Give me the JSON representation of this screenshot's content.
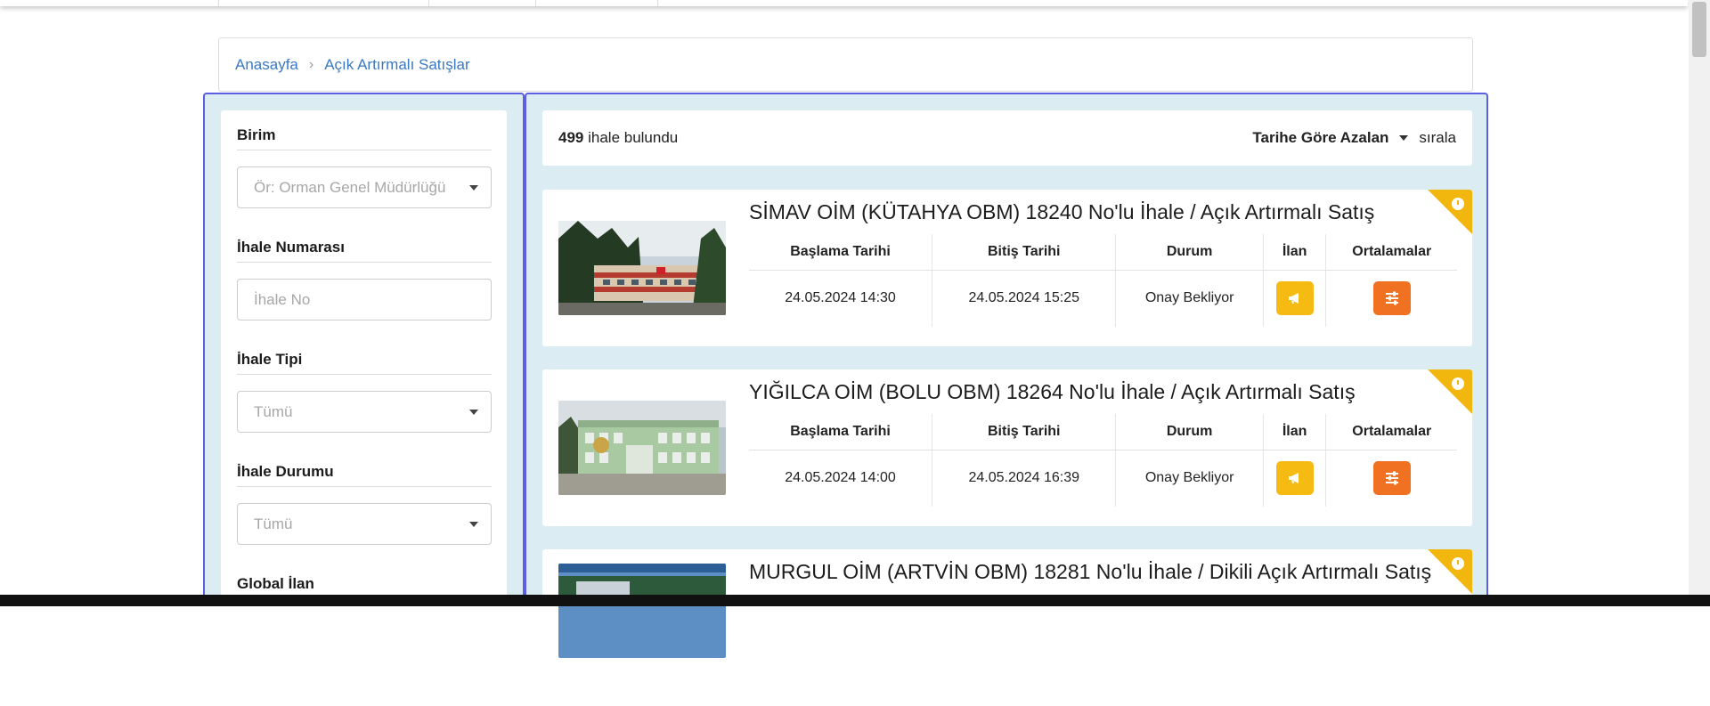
{
  "breadcrumb": {
    "home": "Anasayfa",
    "current": "Açık Artırmalı Satışlar"
  },
  "filters": [
    {
      "label": "Birim",
      "placeholder": "Ör: Orman Genel Müdürlüğü",
      "type": "select"
    },
    {
      "label": "İhale Numarası",
      "placeholder": "İhale No",
      "type": "input"
    },
    {
      "label": "İhale Tipi",
      "placeholder": "Tümü",
      "type": "select"
    },
    {
      "label": "İhale Durumu",
      "placeholder": "Tümü",
      "type": "select"
    },
    {
      "label": "Global İlan"
    }
  ],
  "summary": {
    "count": "499",
    "count_text": "ihale bulundu",
    "sort_label": "Tarihe Göre Azalan",
    "sort_suffix": "sırala"
  },
  "table_headers": [
    "Başlama Tarihi",
    "Bitiş Tarihi",
    "Durum",
    "İlan",
    "Ortalamalar"
  ],
  "listings": [
    {
      "title": "SİMAV OİM (KÜTAHYA OBM) 18240 No'lu İhale / Açık Artırmalı Satış",
      "start": "24.05.2024 14:30",
      "end": "24.05.2024 15:25",
      "status": "Onay Bekliyor"
    },
    {
      "title": "YIĞILCA OİM (BOLU OBM) 18264 No'lu İhale / Açık Artırmalı Satış",
      "start": "24.05.2024 14:00",
      "end": "24.05.2024 16:39",
      "status": "Onay Bekliyor"
    },
    {
      "title": "MURGUL OİM (ARTVİN OBM) 18281 No'lu İhale / Dikili Açık Artırmalı Satış"
    }
  ],
  "colors": {
    "accent_blue": "#3a78c2",
    "panel_border": "#5b5fe0",
    "panel_bg": "#dbecf3",
    "ilan_button": "#f5bb13",
    "ortalama_button": "#f07122",
    "corner_badge": "#f2b70f"
  },
  "icons": {
    "ilan": "megaphone-icon",
    "ortalamalar": "sliders-icon",
    "corner": "clock-icon",
    "breadcrumb_separator": "chevron-right-icon"
  }
}
